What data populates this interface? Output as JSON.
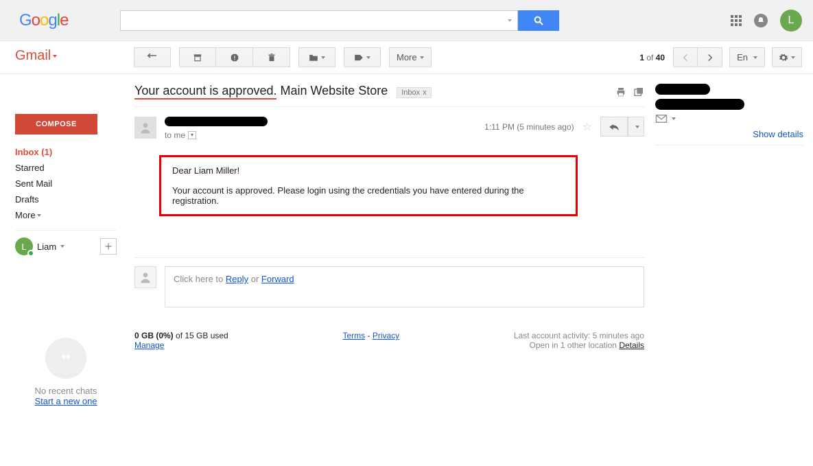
{
  "header": {
    "avatar_letter": "L"
  },
  "gmail_label": "Gmail",
  "compose": "COMPOSE",
  "nav": {
    "inbox": "Inbox (1)",
    "starred": "Starred",
    "sent": "Sent Mail",
    "drafts": "Drafts",
    "more": "More"
  },
  "user": {
    "name": "Liam",
    "initial": "L"
  },
  "hangouts": {
    "empty": "No recent chats",
    "start": "Start a new one"
  },
  "toolbar": {
    "more": "More",
    "count_pos": "1",
    "count_of": " of ",
    "count_total": "40",
    "lang": "En"
  },
  "subject": {
    "part1": "Your account is approved.",
    "part2": " Main Website Store",
    "tag": "Inbox",
    "tag_x": "x"
  },
  "message": {
    "to": "to me",
    "time": "1:11 PM (5 minutes ago)",
    "body_greeting": "Dear Liam Miller!",
    "body_text": "Your account is approved. Please login using the credentials you have entered during the registration."
  },
  "reply_box": {
    "prefix": "Click here to ",
    "reply": "Reply",
    "or": " or ",
    "forward": "Forward"
  },
  "footer": {
    "storage_bold": "0 GB (0%) ",
    "storage_rest": "of 15 GB used",
    "manage": "Manage",
    "terms": "Terms",
    "dash": " - ",
    "privacy": "Privacy",
    "activity": "Last account activity: 5 minutes ago",
    "open_in": "Open in 1 other location  ",
    "details": "Details"
  },
  "rightpane": {
    "show_details": "Show details"
  }
}
